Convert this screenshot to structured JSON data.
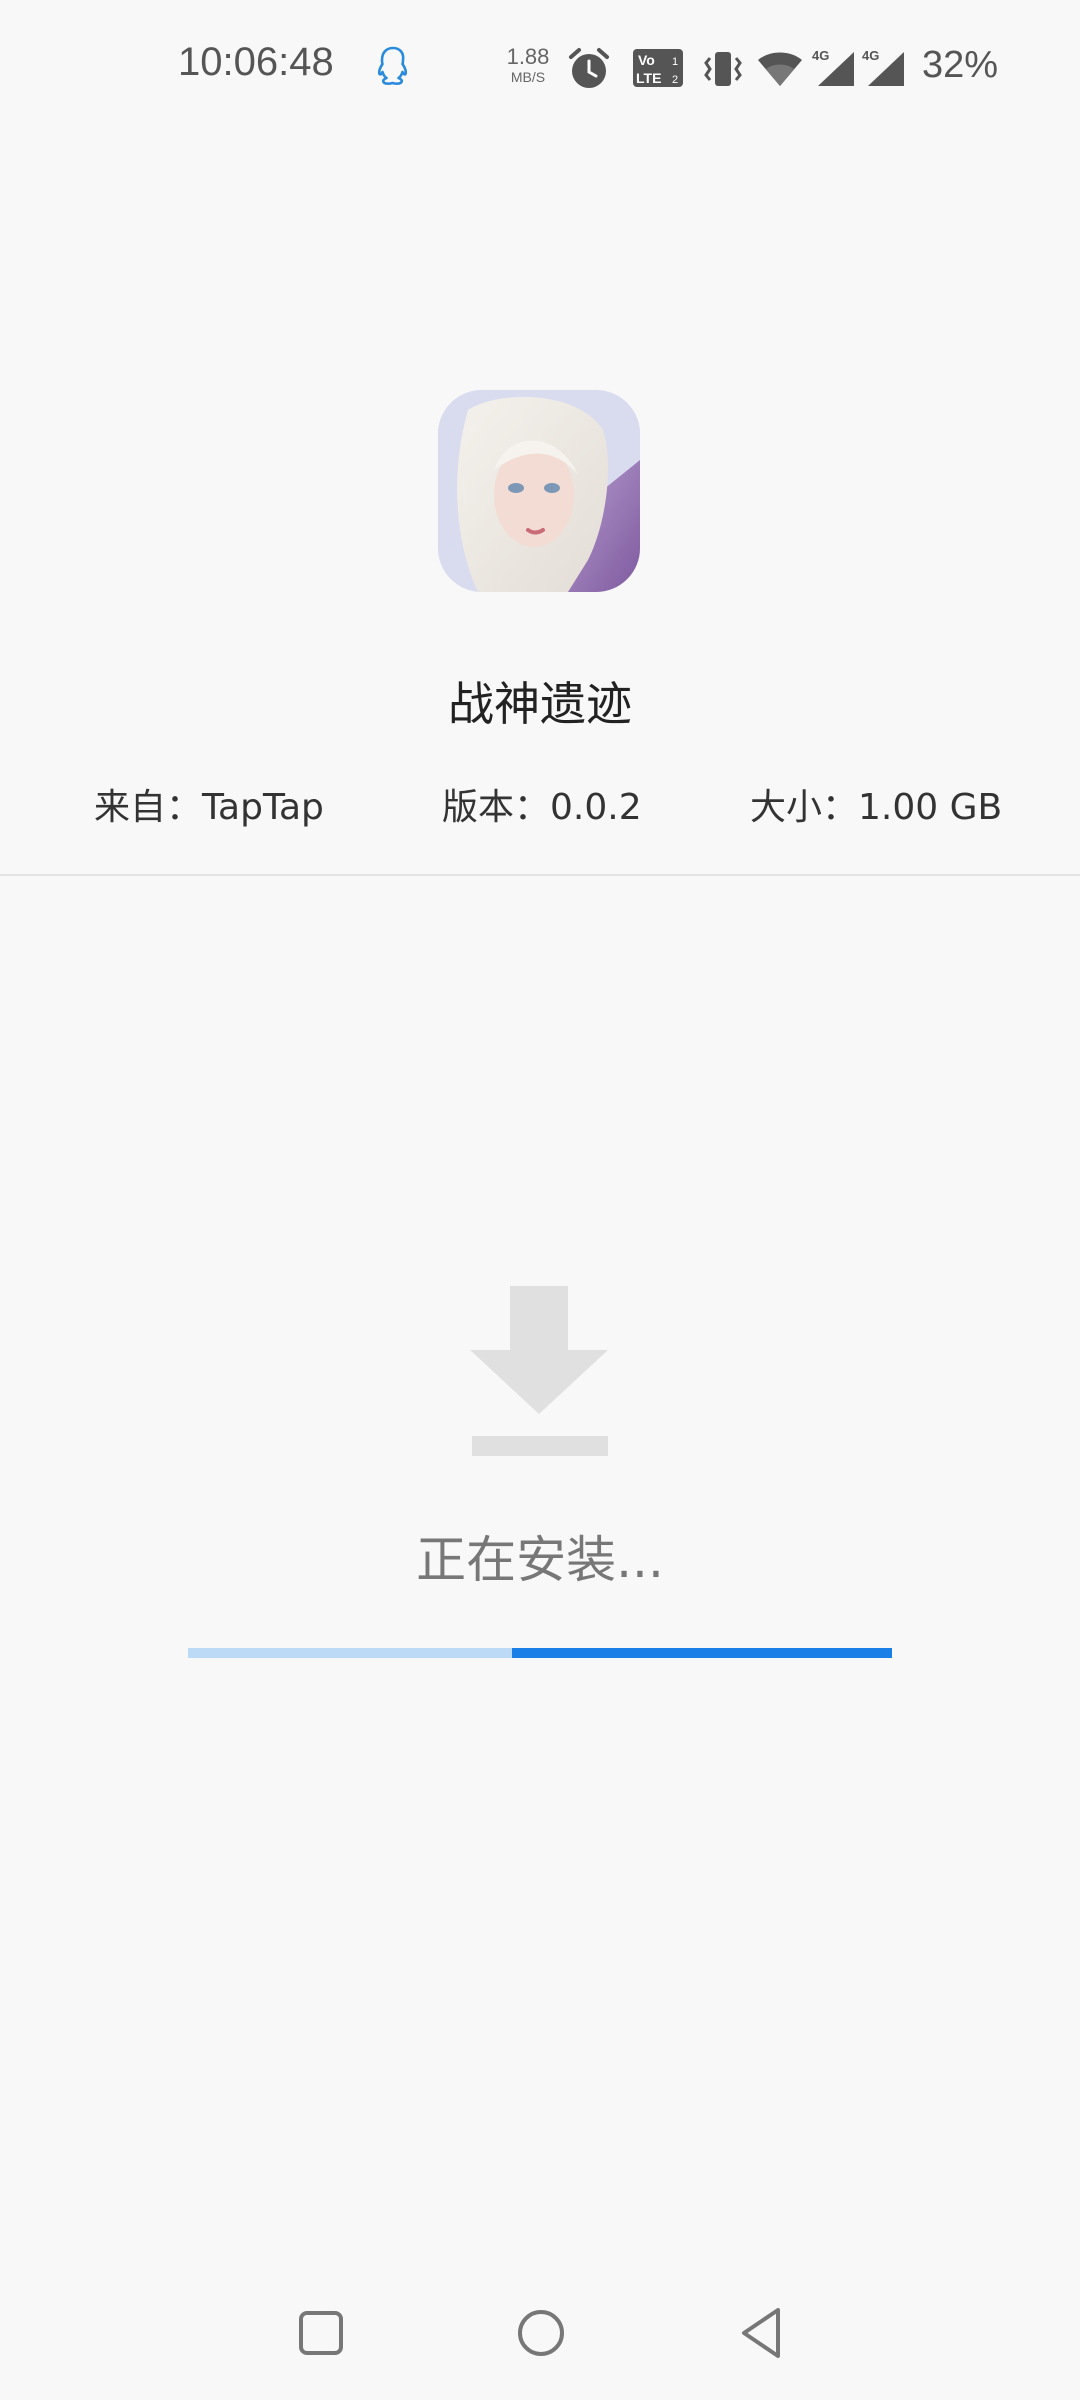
{
  "status_bar": {
    "time": "10:06:48",
    "net_speed_value": "1.88",
    "net_speed_unit": "MB/S",
    "battery": "32%",
    "network_1": "4G",
    "network_2": "4G",
    "volte_top": "Vo",
    "volte_bottom": "LTE",
    "icons": [
      "qq-icon",
      "alarm-icon",
      "volte-icon",
      "vibrate-icon",
      "wifi-icon",
      "signal-icon",
      "signal-icon"
    ]
  },
  "app": {
    "name": "战神遗迹",
    "source": "来自：TapTap",
    "version": "版本：0.0.2",
    "size": "大小：1.00 GB"
  },
  "install": {
    "status_text": "正在安装...",
    "progress_start": 0.46,
    "progress_end": 1.0,
    "colors": {
      "track": "#bcd9f6",
      "fill": "#1a7fe6",
      "icon": "#e0e0e0"
    }
  },
  "nav_bar": {
    "icons": [
      "recent-apps-icon",
      "home-icon",
      "back-icon"
    ]
  }
}
